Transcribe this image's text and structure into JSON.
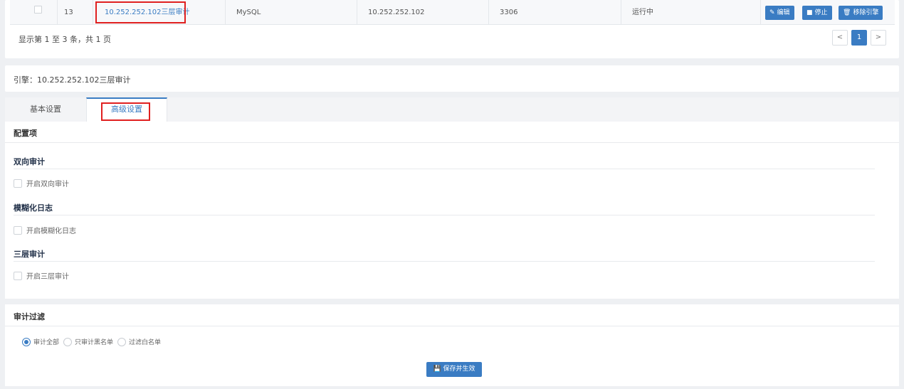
{
  "table": {
    "row": {
      "id": "13",
      "name": "10.252.252.102三层审计",
      "type": "MySQL",
      "ip": "10.252.252.102",
      "port": "3306",
      "status": "运行中",
      "actions": {
        "edit": "编辑",
        "stop": "停止",
        "remove": "移除引擎"
      }
    },
    "summary": "显示第 1 至 3 条，共 1 页",
    "pagination": {
      "prev": "<",
      "current": "1",
      "next": ">"
    }
  },
  "engine": {
    "label": "引擎：10.252.252.102三层审计"
  },
  "tabs": [
    {
      "label": "基本设置"
    },
    {
      "label": "高级设置"
    }
  ],
  "config": {
    "title": "配置项",
    "groups": [
      {
        "title": "双向审计",
        "option": "开启双向审计",
        "checked": false
      },
      {
        "title": "模糊化日志",
        "option": "开启模糊化日志",
        "checked": false
      },
      {
        "title": "三层审计",
        "option": "开启三层审计",
        "checked": false
      }
    ]
  },
  "filter": {
    "title": "审计过滤",
    "options": [
      {
        "label": "审计全部",
        "selected": true
      },
      {
        "label": "只审计黑名单",
        "selected": false
      },
      {
        "label": "过滤白名单",
        "selected": false
      }
    ],
    "save_label": "保存并生效"
  },
  "icons": {
    "edit": "edit-icon",
    "stop": "stop-icon",
    "remove": "trash-icon",
    "save": "save-icon"
  },
  "colors": {
    "accent": "#3a7cc3",
    "highlight": "#e02020"
  }
}
